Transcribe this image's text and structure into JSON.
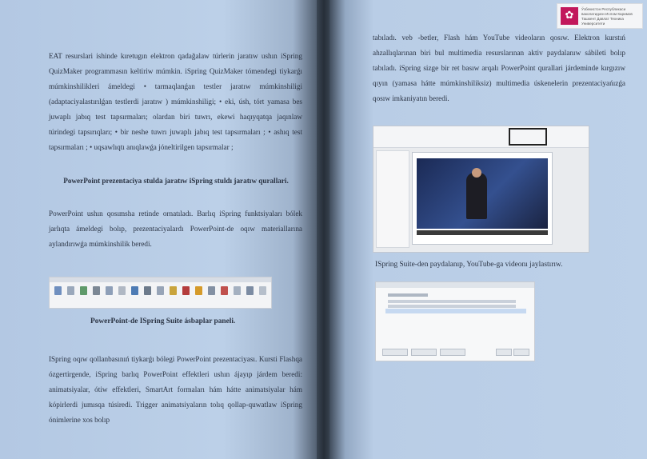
{
  "left_page": {
    "paragraph_1": "EAT resurslari ishinde kıretugın elektron qadağalaw túrlerin jaratıw ushın iSpring QuizMaker programmasın keltiriw múmkin. iSpring QuizMaker tómendegi tiykarǵı múmkinshilikleri ámeldegi • tarmaqlanǵan testler jaratıw múmkinshiligi (adaptaciyalastırılǵan testlerdi jaratıw ) múmkinshiligi; • eki, úsh, tórt yamasa bes juwaplı jabıq test tapsırmaları; olardan biri tuwrı, ekewi haqıyqatqa jaqınlaw túrindegi tapsırıqları; • bir neshe tuwrı juwaplı jabıq test tapsırmaları ; • ashıq test tapsırmaları ; • uqsawlıqtı anıqlawǵa jóneltirilgen tapsırmalar ;",
    "heading": "PowerPoint prezentaciya stulda jaratıw iSpring stuldı jaratıw qurallari.",
    "paragraph_2": "PowerPoint ushın qosımsha retinde ornatıladı. Barlıq iSpring funktsiyaları bólek jarlıqta ámeldegi bolıp, prezentaciyalardı PowerPoint-de oqıw materiallarına aylandırıwǵa múmkinshilik beredi.",
    "caption": "PowerPoint-de ISpring Suite ásbaplar paneli.",
    "paragraph_3": "ISpring oqıw qollanbasınıń tiykarǵı bólegi PowerPoint prezentaciyası. Kursti Flashqa ózgertirgende, iSpring barlıq PowerPoint effektleri ushın ájayıp járdem beredi: animatsiyalar, ótiw effektleri, SmartArt formaları hám hátte animatsiyalar hám kópirlerdi jumısqa túsiredi. Trigger animatsiyaların tolıq qollap-quwatlaw iSpring ónimlerine xos bolıp"
  },
  "right_page": {
    "paragraph_1": "tabıladı. veb -betler, Flash hám YouTube videoların qosıw. Elektron kurstıń ahzallıqlarınan biri bul multimedia resurslarınan aktiv paydalanıw sábileti bolıp tabıladı. iSpring sizge bir ret basıw arqalı PowerPoint qurallari járdeminde kırgızıw qıyın (yamasa hátte múmkinshiliksiz) multimedia úskenelerin prezentaciyańızǵa qosıw imkaniyatın beredi.",
    "caption": "ISpring Suite-den paydalanıp, YouTube-ga videonı jaylastırıw.",
    "badge_text": "Ўзбекистон Республикаси ваколатидаги Ислом Каримов Ташкент Давлат Техника Университети"
  },
  "colors": {
    "page": "#b9cde6",
    "text": "#2b3444",
    "logo": "#c2185b"
  },
  "icons": {
    "logo": "flower-logo-icon"
  }
}
